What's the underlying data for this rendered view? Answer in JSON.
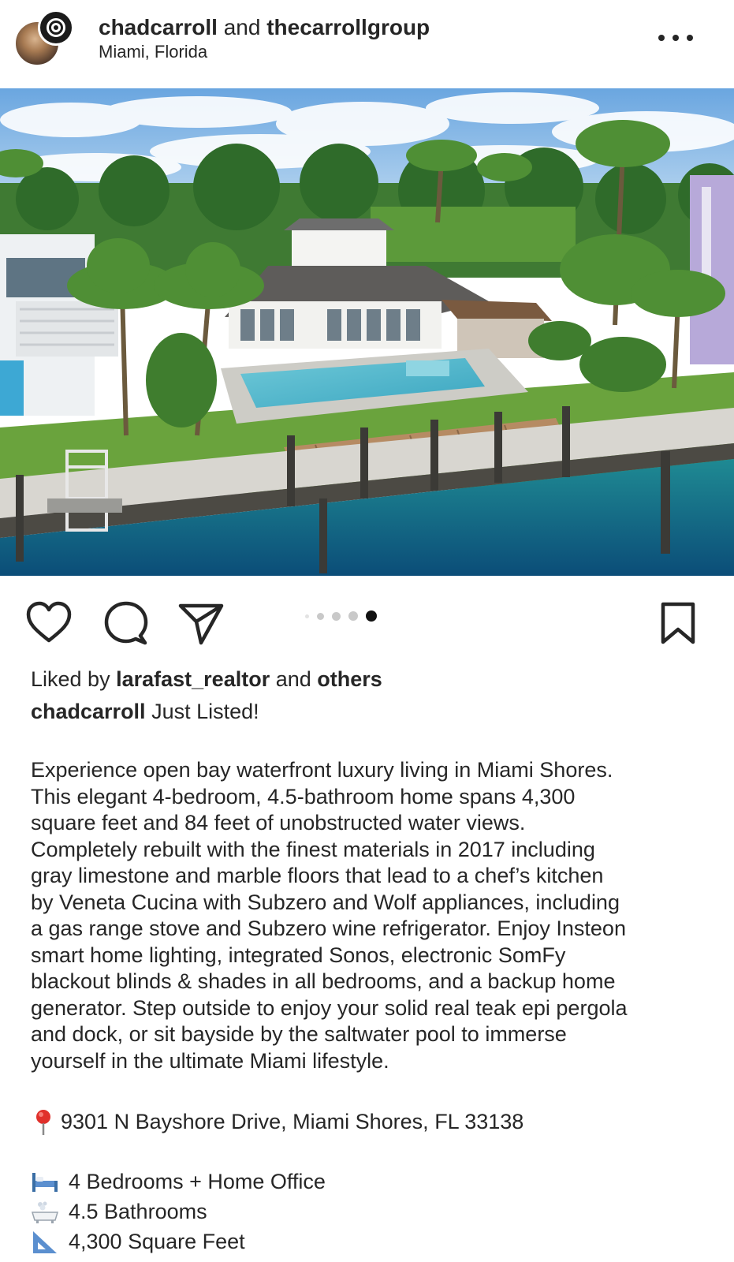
{
  "header": {
    "user1": "chadcarroll",
    "conjunction": "and",
    "user2": "thecarrollgroup",
    "location": "Miami, Florida",
    "more_icon": "more-horizontal-icon"
  },
  "post": {
    "image_alt": "aerial-waterfront-home-photo",
    "carousel": {
      "total": 5,
      "active_index": 4
    }
  },
  "actions": {
    "like_icon": "heart-icon",
    "comment_icon": "comment-icon",
    "share_icon": "send-icon",
    "save_icon": "bookmark-icon"
  },
  "likes": {
    "prefix": "Liked by",
    "user": "larafast_realtor",
    "conjunction": "and",
    "others": "others"
  },
  "caption": {
    "author": "chadcarroll",
    "headline": "Just Listed!",
    "body_lines": [
      "Experience open bay waterfront luxury living in Miami Shores.",
      "This elegant 4-bedroom, 4.5-bathroom home spans 4,300",
      "square feet and 84 feet of unobstructed water views.",
      "Completely rebuilt with the finest materials in 2017 including",
      "gray limestone and marble floors that lead to a chef’s kitchen",
      "by Veneta Cucina with Subzero and Wolf appliances, including",
      "a gas range stove and Subzero wine refrigerator. Enjoy Insteon",
      "smart home lighting, integrated Sonos, electronic SomFy",
      "blackout blinds & shades in all bedrooms, and a backup home",
      "generator. Step outside to enjoy your solid real teak epi pergola",
      "and dock, or sit bayside by the saltwater pool to immerse",
      "yourself in the ultimate Miami lifestyle."
    ],
    "address_icon": "pin-icon",
    "address": "9301 N Bayshore Drive, Miami Shores, FL 33138",
    "features": [
      {
        "icon": "bed-icon",
        "text": "4 Bedrooms + Home Office"
      },
      {
        "icon": "bathtub-icon",
        "text": "4.5 Bathrooms"
      },
      {
        "icon": "triangle-ruler-icon",
        "text": "4,300 Square Feet"
      }
    ]
  }
}
